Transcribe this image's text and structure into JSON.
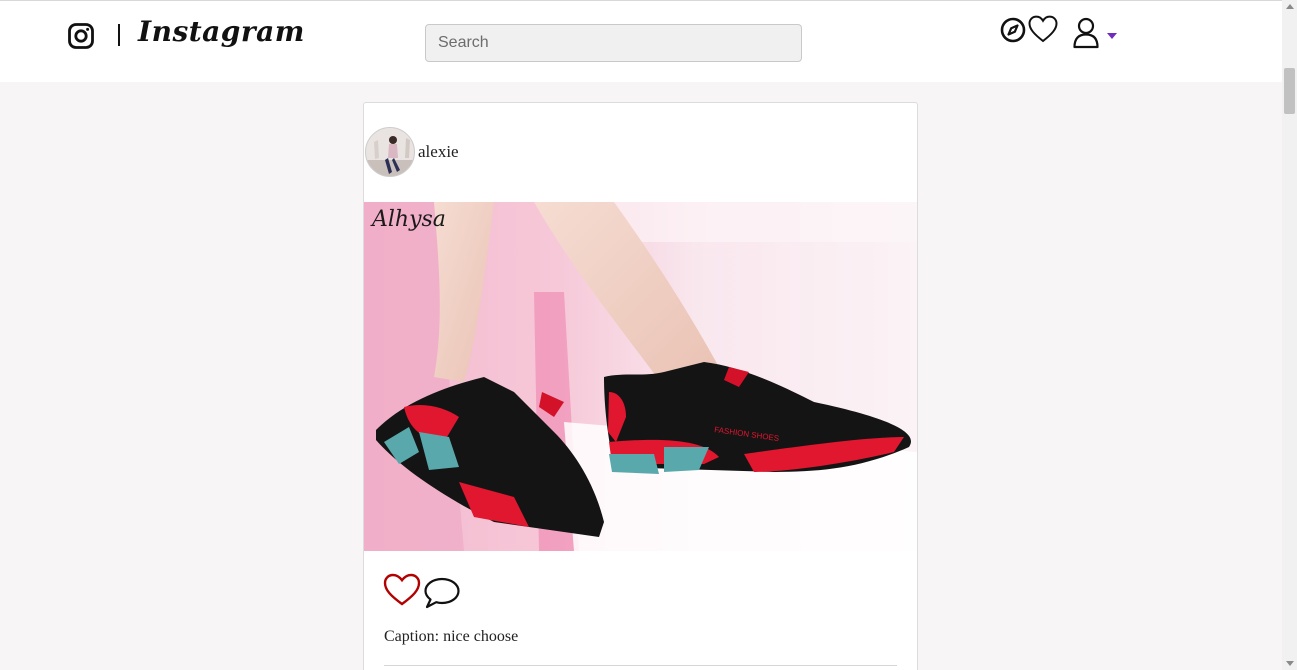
{
  "header": {
    "brand": "Instagram",
    "separator": "|",
    "search": {
      "placeholder": "Search",
      "value": ""
    },
    "icons": [
      "instagram-logo-icon",
      "explore-compass-icon",
      "heart-icon",
      "user-icon",
      "caret-down-icon"
    ],
    "accent_color": "#6f2dbd"
  },
  "post": {
    "username": "alexie",
    "image_watermark": "Alhysa",
    "image_shoe_text": "FASHION SHOES",
    "caption": "Caption: nice choose",
    "like_color": "#b30000"
  }
}
